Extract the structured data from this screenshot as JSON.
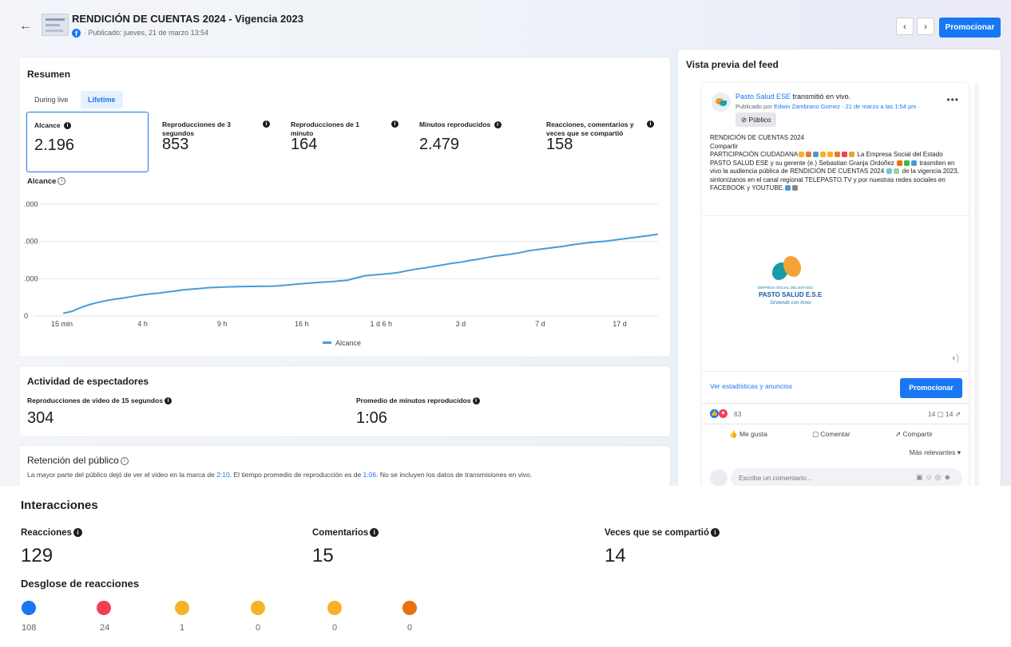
{
  "header": {
    "title": "RENDICIÓN DE CUENTAS 2024 - Vigencia 2023",
    "subtitle": "· Publicado: jueves, 21 de marzo 13:54",
    "back": "←",
    "prev": "‹",
    "next": "›",
    "promote": "Promocionar"
  },
  "resumen": {
    "title": "Resumen",
    "tabs": [
      "During live",
      "Lifetime"
    ],
    "active_tab": "Lifetime",
    "metrics": [
      {
        "label": "Alcance",
        "value": "2.196"
      },
      {
        "label": "Reproducciones de 3 segundos",
        "value": "853"
      },
      {
        "label": "Reproducciones de 1 minuto",
        "value": "164"
      },
      {
        "label": "Minutos reproducidos",
        "value": "2.479"
      },
      {
        "label": "Reacciones, comentarios y veces que se compartió",
        "value": "158"
      }
    ],
    "chart_label": "Alcance"
  },
  "chart_data": {
    "type": "line",
    "title": "Alcance",
    "x_ticks": [
      "15 min",
      "4 h",
      "9 h",
      "16 h",
      "1 d 6 h",
      "3 d",
      "7 d",
      "17 d"
    ],
    "y_ticks": [
      "0",
      ".000",
      ".000",
      ".000"
    ],
    "ylim": [
      0,
      3000
    ],
    "legend": "Alcance",
    "legend_position": "bottom",
    "grid": true,
    "series": [
      {
        "name": "Alcance",
        "color": "#4a9bd7",
        "values": [
          70,
          120,
          220,
          300,
          360,
          410,
          450,
          480,
          520,
          560,
          590,
          610,
          640,
          670,
          700,
          720,
          740,
          760,
          770,
          780,
          785,
          790,
          792,
          795,
          800,
          810,
          830,
          850,
          870,
          890,
          905,
          920,
          940,
          960,
          1020,
          1080,
          1100,
          1120,
          1140,
          1170,
          1220,
          1260,
          1290,
          1330,
          1370,
          1410,
          1440,
          1480,
          1520,
          1560,
          1600,
          1630,
          1660,
          1700,
          1750,
          1780,
          1810,
          1840,
          1870,
          1910,
          1940,
          1970,
          1990,
          2010,
          2040,
          2070,
          2100,
          2130,
          2160,
          2196
        ]
      }
    ]
  },
  "actividad": {
    "title": "Actividad de espectadores",
    "m1_label": "Reproducciones de video de 15 segundos",
    "m1_value": "304",
    "m2_label": "Promedio de minutos reproducidos",
    "m2_value": "1:06"
  },
  "retencion": {
    "title": "Retención del público",
    "text_a": "La mayor parte del público dejó de ver el video en la marca de ",
    "t1": "2:10",
    "text_b": ". El tiempo promedio de reproducción es de ",
    "t2": "1:06",
    "text_c": ". No se incluyen los datos de transmisiones en vivo."
  },
  "feed": {
    "title": "Vista previa del feed",
    "page_name": "Pasto Salud ESE",
    "transmitted": " transmitió en vivo.",
    "published_by": "Publicado por ",
    "author": "Edwin Zambrano Gomez",
    "date": " · 21 de marzo a las 1:54 pm ·",
    "more": "•••",
    "audience": "Público",
    "text_line1": "RENDICIÓN DE CUENTAS 2024",
    "text_line2": "Compartir",
    "text_line3a": "PARTICIPACIÓN CIUDADANA",
    "text_line3b": " La Empresa Social del Estado PASTO SALUD ESE y su gerente (e.)  Sebastian Granja Ordoñez ",
    "text_line3c": " trasmiten en vivo la audiencia pública de RENDICIÓN DE CUENTAS 2024 ",
    "text_line3d": " de la vigencia 2023, sintonízanos en el canal regional TELEPASTO.TV y por nuestras redes sociales en FACEBOOK y YOUTUBE.",
    "logo_line1": "EMPRESA SOCIAL DEL ESTADO",
    "logo_line2": "PASTO SALUD E.S.E",
    "logo_line3": "Sirviendo con Amor",
    "stats_link": "Ver estadísticas y anuncios",
    "promote": "Promocionar",
    "reactions_count": "63",
    "comments_shares": "14 ▢  14 ⇗",
    "like": "Me gusta",
    "comment": "Comentar",
    "share": "Compartir",
    "sort": "Más relevantes ▾",
    "comment_placeholder": "Escribe un comentario..."
  },
  "interacciones": {
    "title": "Interacciones",
    "reacciones_label": "Reacciones",
    "reacciones_value": "129",
    "comentarios_label": "Comentarios",
    "comentarios_value": "15",
    "compartido_label": "Veces que se compartió",
    "compartido_value": "14",
    "desglose_title": "Desglose de reacciones",
    "breakdown": [
      {
        "name": "like",
        "color": "#1877f2",
        "count": "108"
      },
      {
        "name": "love",
        "color": "#f33e58",
        "count": "24"
      },
      {
        "name": "haha",
        "color": "#f7b125",
        "count": "1"
      },
      {
        "name": "wow",
        "color": "#f7b125",
        "count": "0"
      },
      {
        "name": "sad",
        "color": "#f7b125",
        "count": "0"
      },
      {
        "name": "angry",
        "color": "#e9710f",
        "count": "0"
      }
    ]
  }
}
